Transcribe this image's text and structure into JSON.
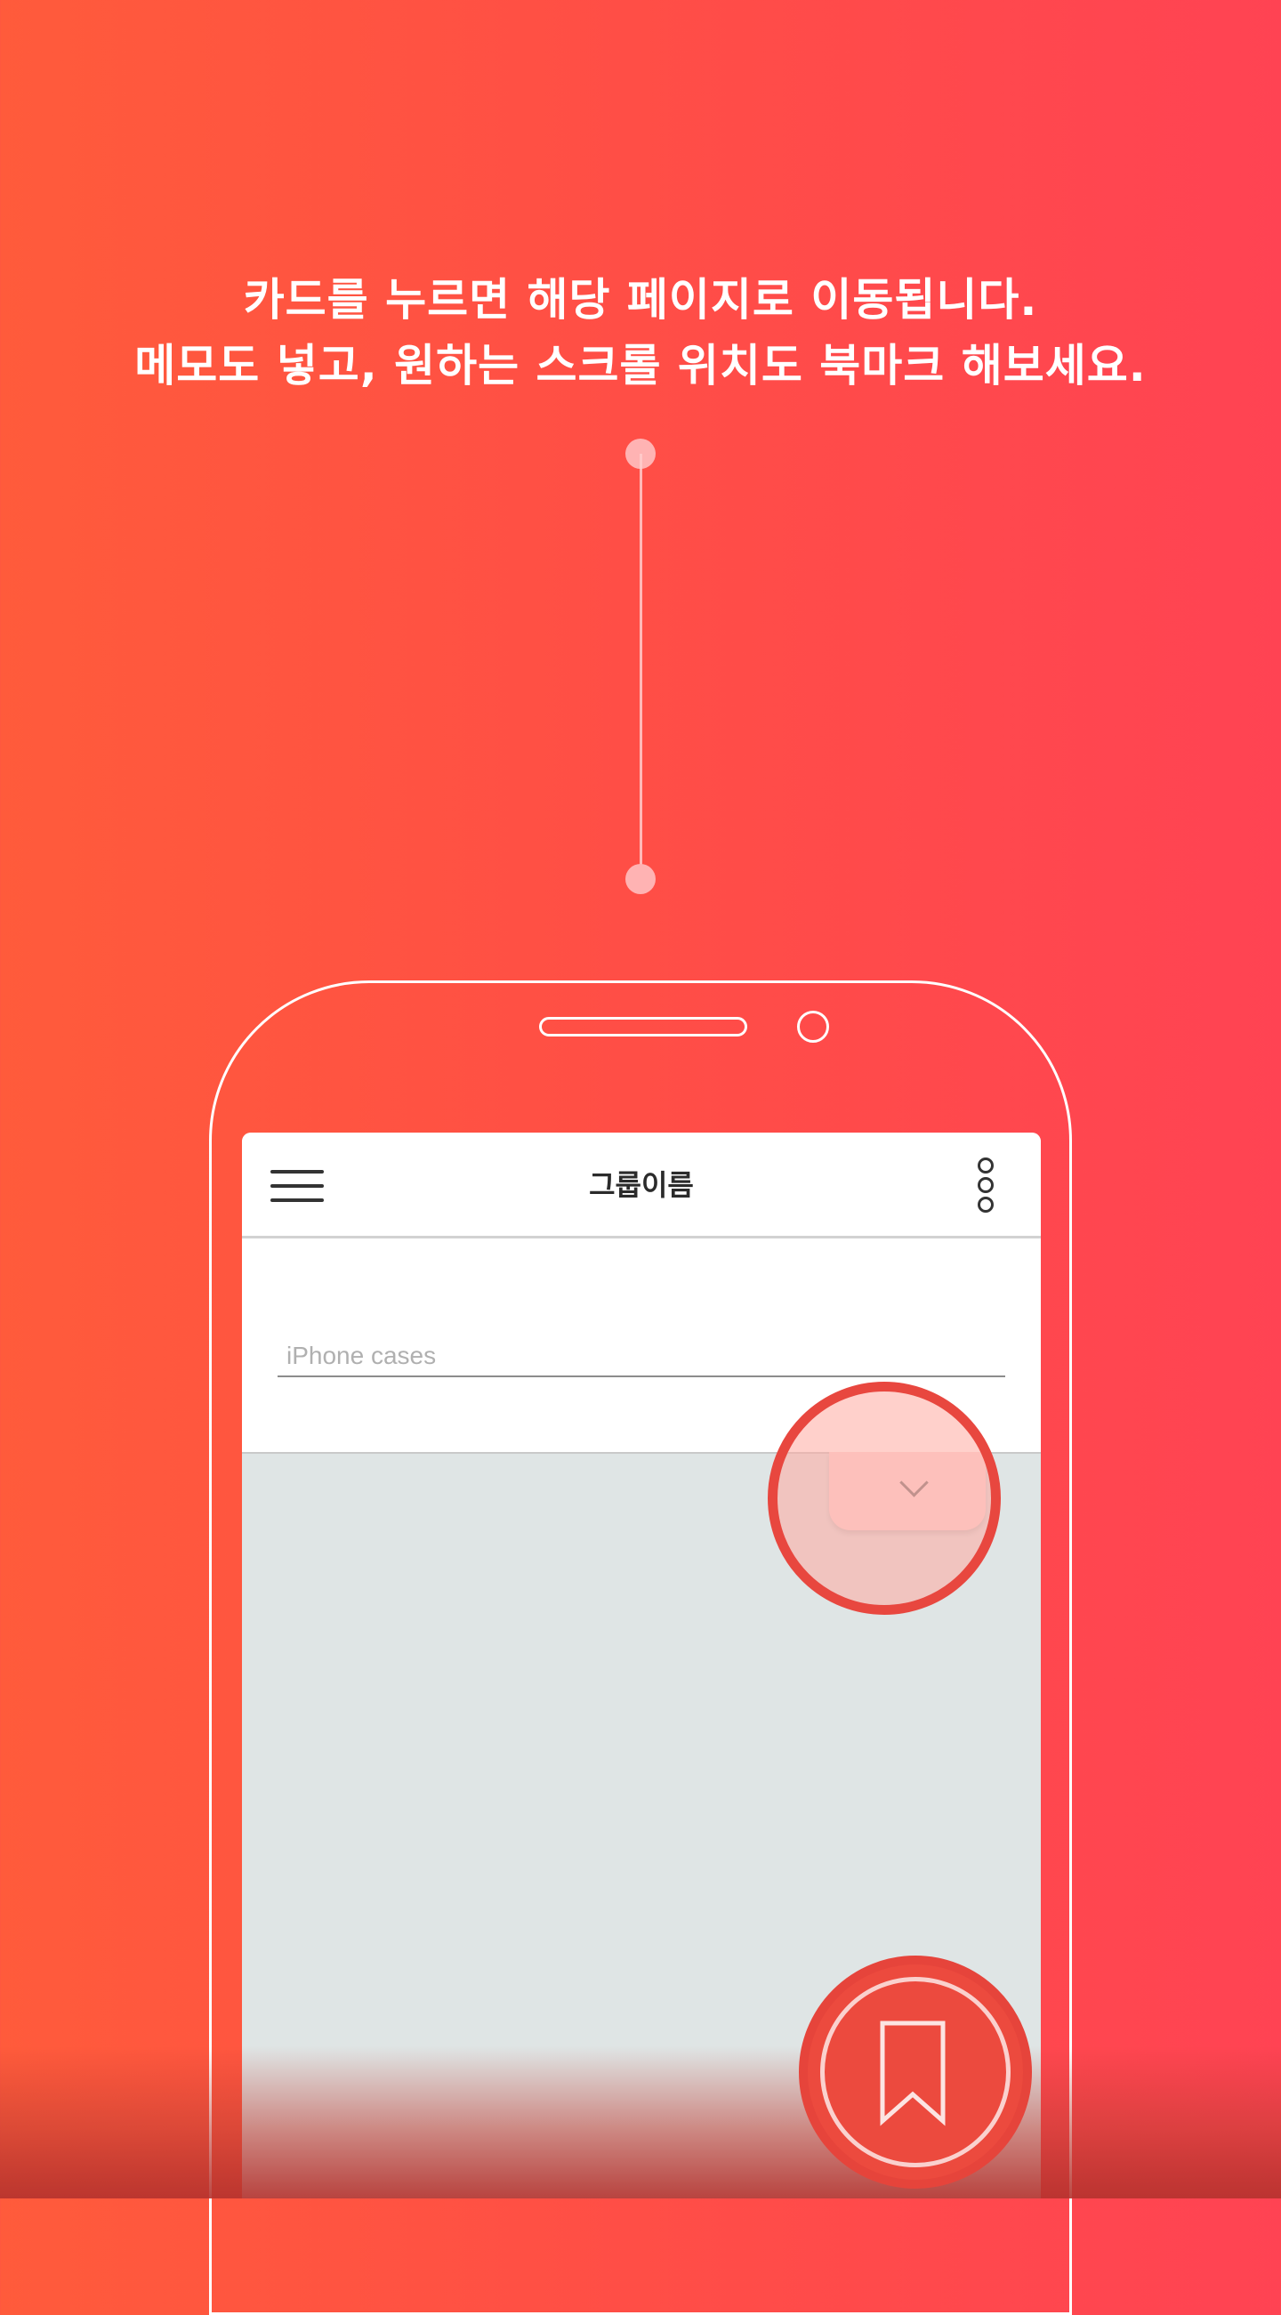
{
  "headline": {
    "line1": "카드를 누르면 해당 페이지로 이동됩니다.",
    "line2": "메모도 넣고, 원하는 스크롤 위치도 북마크 해보세요."
  },
  "app": {
    "title": "그룹이름",
    "menu_icon": "hamburger-menu-icon",
    "more_icon": "more-vertical-icon"
  },
  "card": {
    "memo_placeholder": "iPhone cases",
    "expand_icon": "chevron-down-icon"
  },
  "fab": {
    "icon": "bookmark-icon"
  },
  "colors": {
    "background_start": "#ff5b3b",
    "background_end": "#ff4353",
    "accent": "#e8473f",
    "screen_bg": "#dfe5e5",
    "tab_bg": "#fbdcdc"
  }
}
